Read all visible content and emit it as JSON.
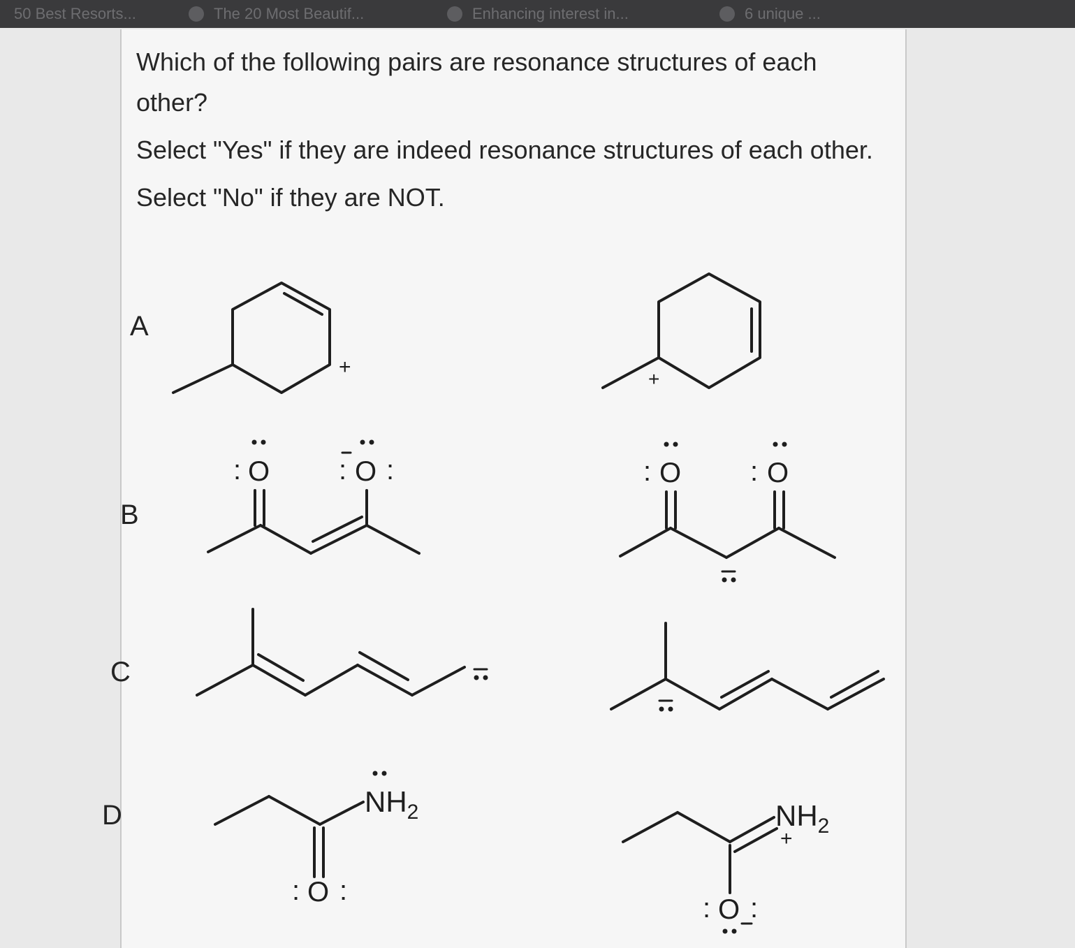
{
  "browser_tabs": [
    {
      "label": "50 Best Resorts..."
    },
    {
      "label": "The 20 Most Beautif..."
    },
    {
      "label": "Enhancing interest in..."
    },
    {
      "label": "6 unique ..."
    }
  ],
  "question": {
    "line1": "Which of the following pairs are resonance structures of each other?",
    "line2": "Select \"Yes\" if they are indeed resonance structures of each other.",
    "line3": "Select \"No\" if they are NOT."
  },
  "pairs": [
    {
      "label": "A"
    },
    {
      "label": "B"
    },
    {
      "label": "C"
    },
    {
      "label": "D"
    }
  ],
  "structure_text": {
    "plus": "+",
    "oxygen": "O",
    "amine": "NH",
    "subscript_two": "2",
    "lone_pair": ":"
  }
}
